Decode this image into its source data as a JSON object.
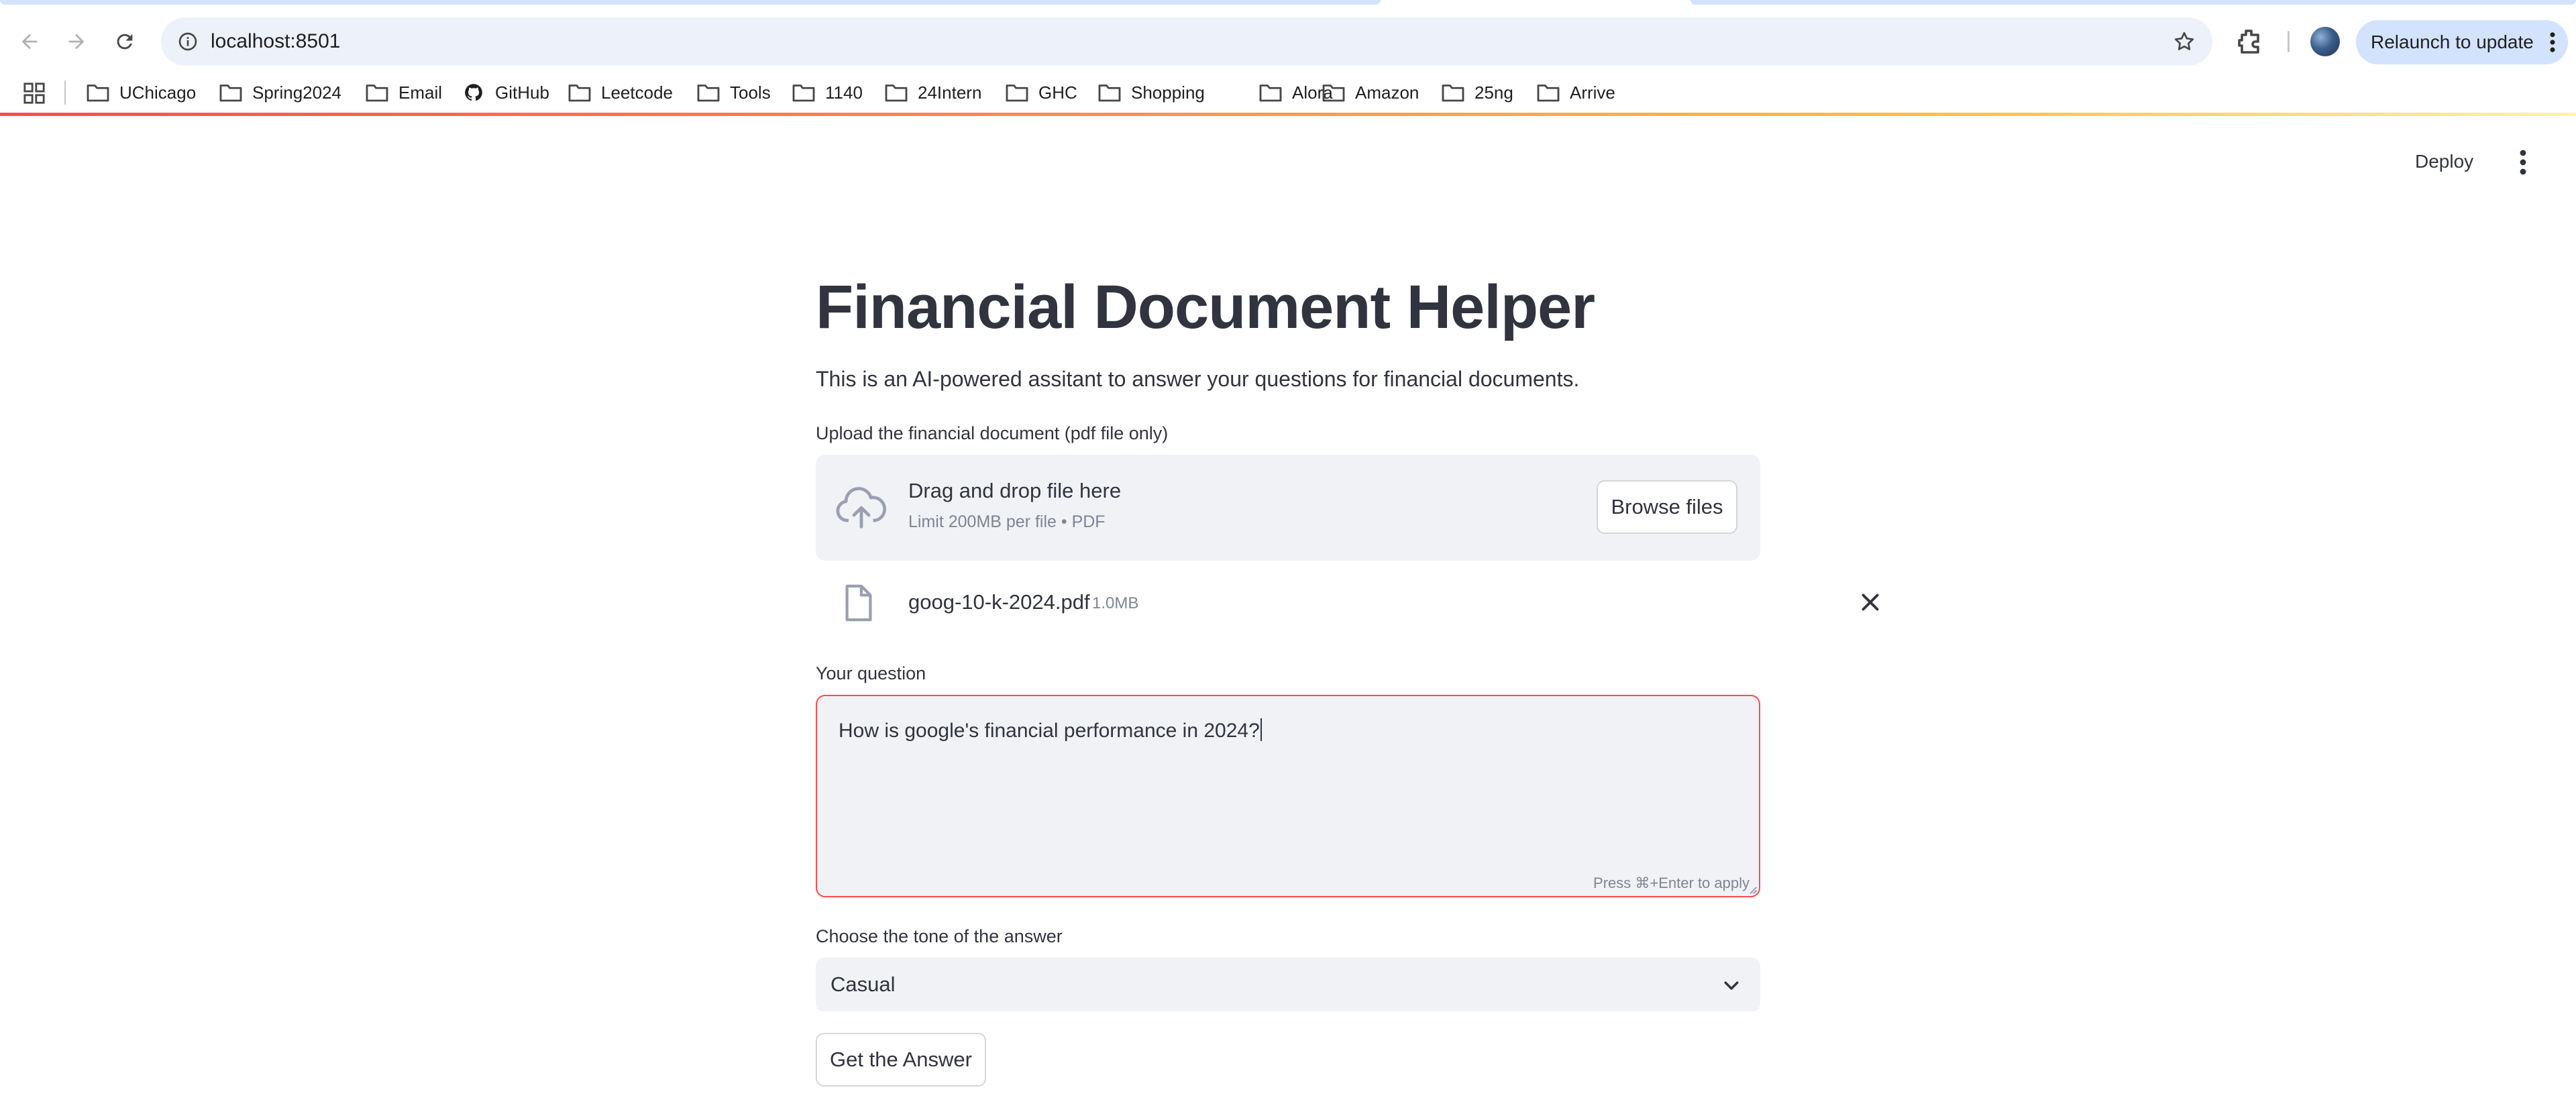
{
  "browser": {
    "url": "localhost:8501",
    "relaunch_label": "Relaunch to update",
    "bookmarks": [
      {
        "label": "UChicago",
        "icon": "folder-icon"
      },
      {
        "label": "Spring2024",
        "icon": "folder-icon"
      },
      {
        "label": "Email",
        "icon": "folder-icon"
      },
      {
        "label": "GitHub",
        "icon": "github-icon"
      },
      {
        "label": "Leetcode",
        "icon": "folder-icon"
      },
      {
        "label": "Tools",
        "icon": "folder-icon"
      },
      {
        "label": "1140",
        "icon": "folder-icon"
      },
      {
        "label": "24Intern",
        "icon": "folder-icon"
      },
      {
        "label": "GHC",
        "icon": "folder-icon"
      },
      {
        "label": "Shopping",
        "icon": "folder-icon"
      },
      {
        "label": "Alora",
        "icon": "folder-icon"
      },
      {
        "label": "Amazon",
        "icon": "folder-icon"
      },
      {
        "label": "25ng",
        "icon": "folder-icon"
      },
      {
        "label": "Arrive",
        "icon": "folder-icon"
      }
    ]
  },
  "app": {
    "deploy_label": "Deploy",
    "title": "Financial Document Helper",
    "subtitle": "This is an AI-powered assitant to answer your questions for financial documents.",
    "upload": {
      "label": "Upload the financial document (pdf file only)",
      "drop_text": "Drag and drop file here",
      "limit_text": "Limit 200MB per file • PDF",
      "browse_label": "Browse files",
      "file": {
        "name": "goog-10-k-2024.pdf",
        "size": "1.0MB"
      }
    },
    "question": {
      "label": "Your question",
      "value": "How is google's financial performance in 2024?",
      "hint": "Press ⌘+Enter to apply"
    },
    "tone": {
      "label": "Choose the tone of the answer",
      "selected": "Casual"
    },
    "submit_label": "Get the Answer"
  },
  "colors": {
    "accent": "#ff4b4b",
    "text": "#31333f",
    "muted": "#808495",
    "input_bg": "#f0f2f6",
    "chrome_pill": "#d3e3fd"
  }
}
